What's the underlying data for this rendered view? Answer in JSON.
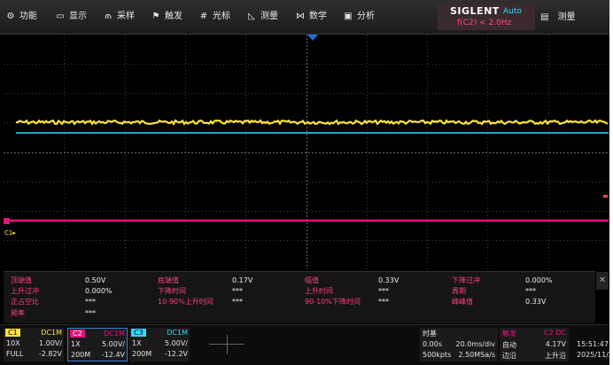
{
  "menu": {
    "items": [
      {
        "icon": "gear-icon",
        "glyph": "⚙",
        "label": "功能"
      },
      {
        "icon": "monitor-icon",
        "glyph": "▭",
        "label": "显示"
      },
      {
        "icon": "sample-icon",
        "glyph": "⫙",
        "label": "采样"
      },
      {
        "icon": "flag-icon",
        "glyph": "⚑",
        "label": "触发"
      },
      {
        "icon": "cursor-icon",
        "glyph": "#",
        "label": "光标"
      },
      {
        "icon": "ruler-icon",
        "glyph": "◺",
        "label": "测量"
      },
      {
        "icon": "math-icon",
        "glyph": "⋈",
        "label": "数学"
      },
      {
        "icon": "analysis-icon",
        "glyph": "▣",
        "label": "分析"
      }
    ],
    "brand": "SIGLENT",
    "mode": "Auto",
    "trigger_summary": "f(C2) < 2.0Hz",
    "measure_label": "测量",
    "measure_icon_glyph": "▤"
  },
  "display": {
    "c1_marker": "C1▸",
    "colors": {
      "c1": "#ffe23b",
      "c2": "#e0147d",
      "c3": "#2fd7ff",
      "grid": "#3c3c3c"
    }
  },
  "measurements": {
    "rows": [
      [
        {
          "label": "顶端值",
          "value": "0.50V"
        },
        {
          "label": "底端值",
          "value": "0.17V"
        },
        {
          "label": "幅值",
          "value": "0.33V"
        },
        {
          "label": "下降过冲",
          "value": "0.000%"
        }
      ],
      [
        {
          "label": "上升过冲",
          "value": "0.000%"
        },
        {
          "label": "下降时间",
          "value": "***"
        },
        {
          "label": "上升时间",
          "value": "***"
        },
        {
          "label": "周期",
          "value": "***"
        }
      ],
      [
        {
          "label": "正占空比",
          "value": "***"
        },
        {
          "label": "10-90%上升时间",
          "value": "***"
        },
        {
          "label": "90-10%下降时间",
          "value": "***"
        },
        {
          "label": "峰峰值",
          "value": "0.33V"
        }
      ],
      [
        {
          "label": "频率",
          "value": "***"
        }
      ]
    ],
    "close_glyph": "✕"
  },
  "channels": [
    {
      "tag": "C1",
      "coupling": "DC1M",
      "probe": "10X",
      "scale": "1.00V/",
      "bw": "FULL",
      "offset": "-2.82V",
      "color": "#ffe23b"
    },
    {
      "tag": "C2",
      "coupling": "DC1M",
      "probe": "1X",
      "scale": "5.00V/",
      "bw": "200M",
      "offset": "-12.4V",
      "color": "#e0147d"
    },
    {
      "tag": "C3",
      "coupling": "DC1M",
      "probe": "1X",
      "scale": "5.00V/",
      "bw": "200M",
      "offset": "-12.2V",
      "color": "#2fd7ff"
    }
  ],
  "timebase": {
    "title": "时基",
    "delay": "0.00s",
    "scale": "20.0ms/div",
    "points": "500kpts",
    "rate": "2.50MSa/s"
  },
  "trigger": {
    "title": "触发",
    "source": "C2 DC",
    "mode": "自动",
    "level": "4.17V",
    "type": "边沿",
    "slope": "上升沿"
  },
  "clock": {
    "time": "15:51:47",
    "date": "2025/11/26"
  }
}
